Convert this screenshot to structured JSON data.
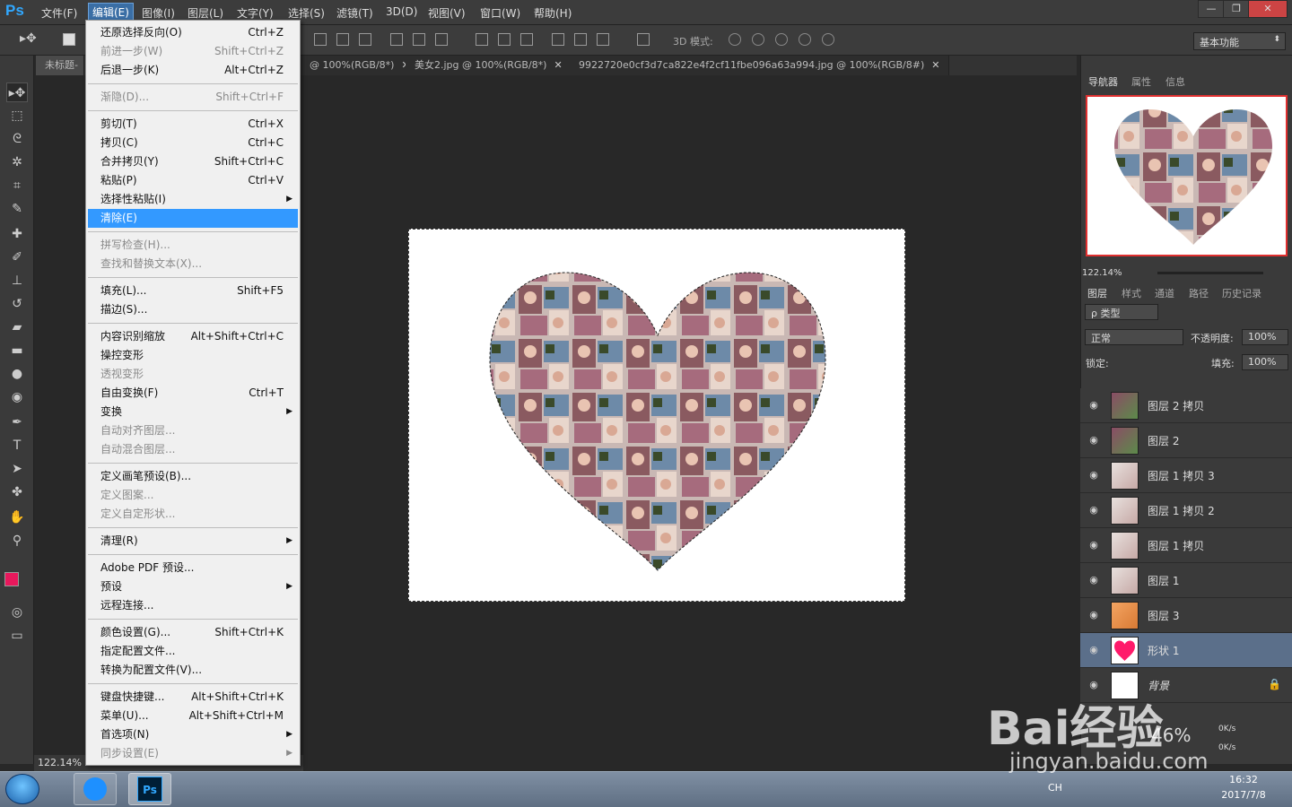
{
  "app": {
    "logo": "Ps"
  },
  "menubar": {
    "items": [
      "文件(F)",
      "编辑(E)",
      "图像(I)",
      "图层(L)",
      "文字(Y)",
      "选择(S)",
      "滤镜(T)",
      "3D(D)",
      "视图(V)",
      "窗口(W)",
      "帮助(H)"
    ]
  },
  "window_controls": {
    "minimize": "—",
    "restore": "❐",
    "close": "✕"
  },
  "options_bar": {
    "mode_3d_label": "3D 模式:",
    "workspace": "基本功能"
  },
  "tabs": [
    {
      "label": "未标题-",
      "close": "✕"
    },
    {
      "label": "@ 100%(RGB/8*)",
      "close": "✕"
    },
    {
      "label": "美女2.jpg @ 100%(RGB/8*)",
      "close": "✕"
    },
    {
      "label": "9922720e0cf3d7ca822e4f2cf11fbe096a63a994.jpg @ 100%(RGB/8#)",
      "close": "✕"
    }
  ],
  "edit_menu": {
    "groups": [
      [
        {
          "label": "还原选择反向(O)",
          "shortcut": "Ctrl+Z",
          "disabled": false
        },
        {
          "label": "前进一步(W)",
          "shortcut": "Shift+Ctrl+Z",
          "disabled": true
        },
        {
          "label": "后退一步(K)",
          "shortcut": "Alt+Ctrl+Z",
          "disabled": false
        }
      ],
      [
        {
          "label": "渐隐(D)...",
          "shortcut": "Shift+Ctrl+F",
          "disabled": true
        }
      ],
      [
        {
          "label": "剪切(T)",
          "shortcut": "Ctrl+X",
          "disabled": false
        },
        {
          "label": "拷贝(C)",
          "shortcut": "Ctrl+C",
          "disabled": false
        },
        {
          "label": "合并拷贝(Y)",
          "shortcut": "Shift+Ctrl+C",
          "disabled": false
        },
        {
          "label": "粘贴(P)",
          "shortcut": "Ctrl+V",
          "disabled": false
        },
        {
          "label": "选择性粘贴(I)",
          "shortcut": "",
          "disabled": false,
          "submenu": true
        },
        {
          "label": "清除(E)",
          "shortcut": "",
          "disabled": false,
          "highlight": true
        }
      ],
      [
        {
          "label": "拼写检查(H)...",
          "shortcut": "",
          "disabled": true
        },
        {
          "label": "查找和替换文本(X)...",
          "shortcut": "",
          "disabled": true
        }
      ],
      [
        {
          "label": "填充(L)...",
          "shortcut": "Shift+F5",
          "disabled": false
        },
        {
          "label": "描边(S)...",
          "shortcut": "",
          "disabled": false
        }
      ],
      [
        {
          "label": "内容识别缩放",
          "shortcut": "Alt+Shift+Ctrl+C",
          "disabled": false
        },
        {
          "label": "操控变形",
          "shortcut": "",
          "disabled": false
        },
        {
          "label": "透视变形",
          "shortcut": "",
          "disabled": true
        },
        {
          "label": "自由变换(F)",
          "shortcut": "Ctrl+T",
          "disabled": false
        },
        {
          "label": "变换",
          "shortcut": "",
          "disabled": false,
          "submenu": true
        },
        {
          "label": "自动对齐图层...",
          "shortcut": "",
          "disabled": true
        },
        {
          "label": "自动混合图层...",
          "shortcut": "",
          "disabled": true
        }
      ],
      [
        {
          "label": "定义画笔预设(B)...",
          "shortcut": "",
          "disabled": false
        },
        {
          "label": "定义图案...",
          "shortcut": "",
          "disabled": true
        },
        {
          "label": "定义自定形状...",
          "shortcut": "",
          "disabled": true
        }
      ],
      [
        {
          "label": "清理(R)",
          "shortcut": "",
          "disabled": false,
          "submenu": true
        }
      ],
      [
        {
          "label": "Adobe PDF 预设...",
          "shortcut": "",
          "disabled": false
        },
        {
          "label": "预设",
          "shortcut": "",
          "disabled": false,
          "submenu": true
        },
        {
          "label": "远程连接...",
          "shortcut": "",
          "disabled": false
        }
      ],
      [
        {
          "label": "颜色设置(G)...",
          "shortcut": "Shift+Ctrl+K",
          "disabled": false
        },
        {
          "label": "指定配置文件...",
          "shortcut": "",
          "disabled": false
        },
        {
          "label": "转换为配置文件(V)...",
          "shortcut": "",
          "disabled": false
        }
      ],
      [
        {
          "label": "键盘快捷键...",
          "shortcut": "Alt+Shift+Ctrl+K",
          "disabled": false
        },
        {
          "label": "菜单(U)...",
          "shortcut": "Alt+Shift+Ctrl+M",
          "disabled": false
        },
        {
          "label": "首选项(N)",
          "shortcut": "",
          "disabled": false,
          "submenu": true
        },
        {
          "label": "同步设置(E)",
          "shortcut": "",
          "disabled": true,
          "submenu": true
        }
      ]
    ]
  },
  "status": {
    "zoom": "122.14%"
  },
  "navigator": {
    "tabs": [
      "导航器",
      "属性",
      "信息"
    ],
    "zoom": "122.14%"
  },
  "layers_panel": {
    "tabs": [
      "图层",
      "样式",
      "通道",
      "路径",
      "历史记录"
    ],
    "filter": "ρ 类型",
    "blend_mode": "正常",
    "opacity_label": "不透明度:",
    "opacity": "100%",
    "lock_label": "锁定:",
    "fill_label": "填充:",
    "fill": "100%",
    "layers": [
      {
        "name": "图层 2 拷贝",
        "thumb": "photo",
        "selected": false
      },
      {
        "name": "图层 2",
        "thumb": "photo",
        "selected": false
      },
      {
        "name": "图层 1 拷贝 3",
        "thumb": "photo-light",
        "selected": false
      },
      {
        "name": "图层 1 拷贝 2",
        "thumb": "photo-light",
        "selected": false
      },
      {
        "name": "图层 1 拷贝",
        "thumb": "photo-light",
        "selected": false
      },
      {
        "name": "图层 1",
        "thumb": "photo-light",
        "selected": false
      },
      {
        "name": "图层 3",
        "thumb": "photo-orange",
        "selected": false
      },
      {
        "name": "形状 1",
        "thumb": "heart",
        "selected": true
      },
      {
        "name": "背景",
        "thumb": "white",
        "selected": false,
        "locked": true
      }
    ]
  },
  "taskbar": {
    "lang": "CH",
    "time": "16:32",
    "date": "2017/7/8",
    "net_up": "0K/s",
    "net_down": "0K/s",
    "net_pct": "46%"
  },
  "watermark": {
    "brand": "Bai经验",
    "url": "jingyan.baidu.com"
  },
  "colors": {
    "foreground": "#e8185c",
    "background": "#111111",
    "highlight": "#3399ff",
    "heart": "#ff1a6a"
  }
}
